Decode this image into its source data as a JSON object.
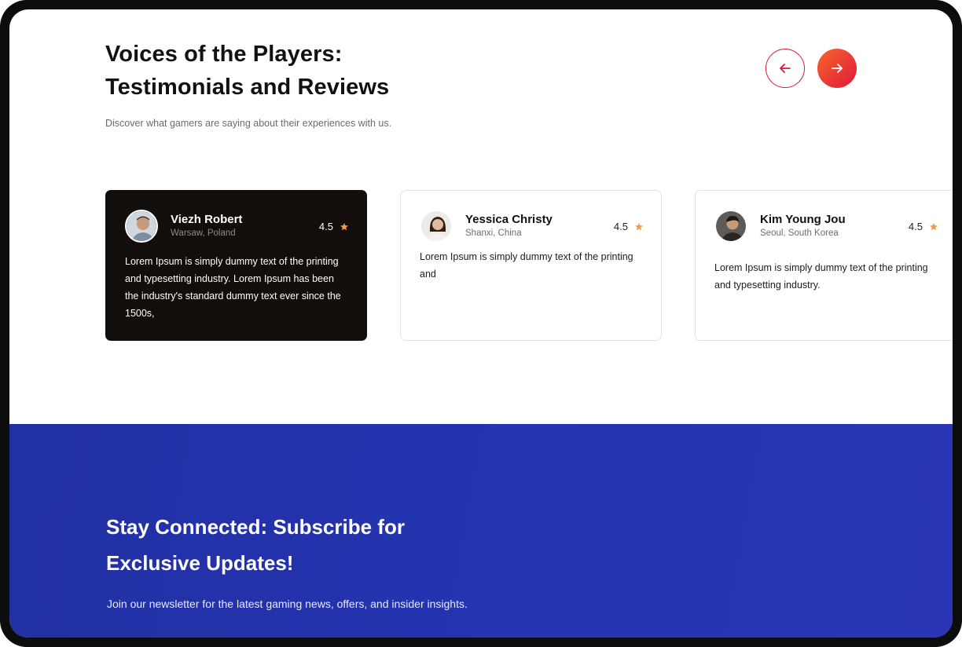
{
  "testimonials": {
    "title_line1": "Voices of the Players:",
    "title_line2": "Testimonials and Reviews",
    "subtitle": "Discover what gamers are saying about their experiences with us.",
    "cards": [
      {
        "name": "Viezh Robert",
        "location": "Warsaw, Poland",
        "rating": "4.5",
        "text": "Lorem Ipsum is simply dummy text of the printing and typesetting industry. Lorem Ipsum has been the industry's standard dummy text ever since the 1500s,",
        "theme": "dark"
      },
      {
        "name": "Yessica Christy",
        "location": "Shanxi, China",
        "rating": "4.5",
        "text": "Lorem Ipsum is simply dummy text of the printing and",
        "theme": "light"
      },
      {
        "name": "Kim Young Jou",
        "location": "Seoul, South Korea",
        "rating": "4.5",
        "text": "Lorem Ipsum is simply dummy text of the printing and typesetting industry.",
        "theme": "light"
      }
    ],
    "nav_icons": [
      "arrow-left-icon",
      "arrow-right-icon"
    ],
    "star_icon": "star-icon"
  },
  "subscribe": {
    "title_line1": "Stay Connected: Subscribe for",
    "title_line2": "Exclusive Updates!",
    "subtitle": "Join our newsletter for the latest gaming news, offers, and insider insights."
  },
  "colors": {
    "accent_red": "#e2183a",
    "accent_orange": "#f5662c",
    "star": "#f2994a",
    "dark_card": "#120e0b",
    "subscribe_bg": "#2534b2"
  }
}
